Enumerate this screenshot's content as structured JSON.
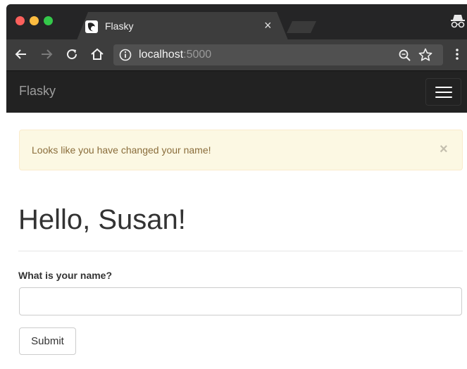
{
  "browser": {
    "tab_title": "Flasky",
    "tab_close": "×",
    "url_host": "localhost",
    "url_port": ":5000"
  },
  "navbar": {
    "brand": "Flasky"
  },
  "alert": {
    "message": "Looks like you have changed your name!",
    "close": "×"
  },
  "page": {
    "heading": "Hello, Susan!"
  },
  "form": {
    "name_label": "What is your name?",
    "name_value": "",
    "submit_label": "Submit"
  },
  "colors": {
    "navbar_bg": "#222222",
    "alert_bg": "#fcf8e3",
    "alert_text": "#8a6d3b"
  }
}
